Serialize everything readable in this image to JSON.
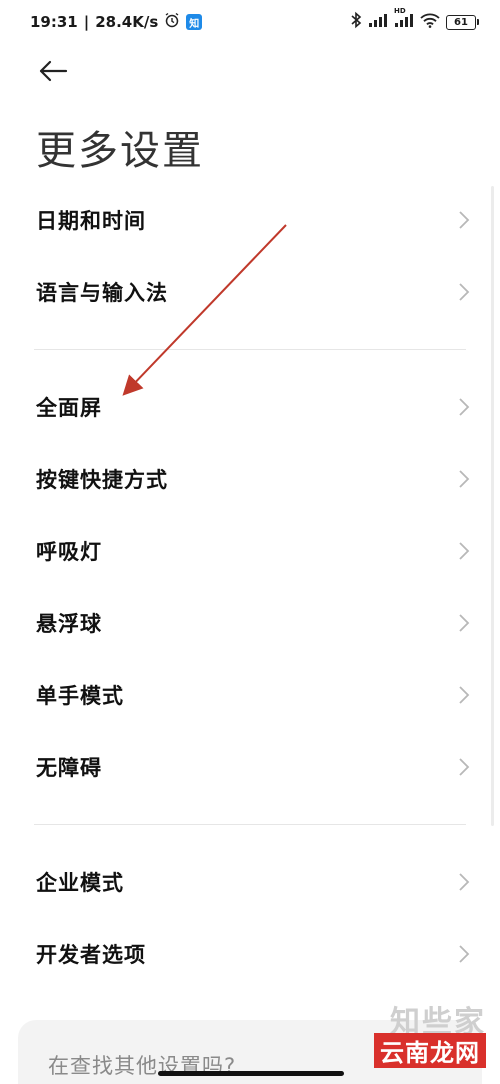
{
  "status_bar": {
    "time": "19:31",
    "separator": "|",
    "speed": "28.4K/s",
    "battery": "61",
    "hd_label": "HD",
    "app_badge": "知"
  },
  "header": {
    "title": "更多设置"
  },
  "settings": {
    "group1": [
      {
        "label": "日期和时间"
      },
      {
        "label": "语言与输入法"
      }
    ],
    "group2": [
      {
        "label": "全面屏"
      },
      {
        "label": "按键快捷方式"
      },
      {
        "label": "呼吸灯"
      },
      {
        "label": "悬浮球"
      },
      {
        "label": "单手模式"
      },
      {
        "label": "无障碍"
      }
    ],
    "group3": [
      {
        "label": "企业模式"
      },
      {
        "label": "开发者选项"
      }
    ]
  },
  "bottom_card": {
    "text": "在查找其他设置吗?"
  },
  "watermark": {
    "top": "知些家",
    "bottom": "云南龙网"
  },
  "colors": {
    "annotation_arrow": "#c0392b",
    "app_badge": "#1e8ae8",
    "watermark_red": "#d9302b"
  }
}
